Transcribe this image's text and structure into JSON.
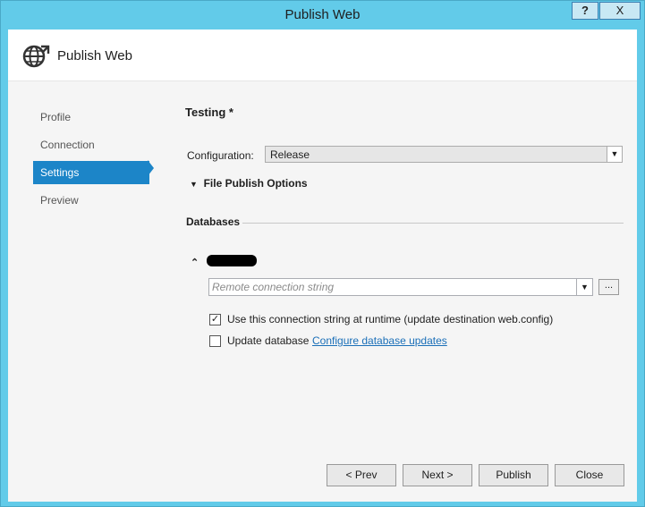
{
  "window": {
    "title": "Publish Web",
    "help_label": "?",
    "close_label": "X"
  },
  "header": {
    "title": "Publish Web",
    "icon": "globe-publish-icon"
  },
  "nav": {
    "items": [
      {
        "label": "Profile",
        "active": false
      },
      {
        "label": "Connection",
        "active": false
      },
      {
        "label": "Settings",
        "active": true
      },
      {
        "label": "Preview",
        "active": false
      }
    ]
  },
  "settings": {
    "profile_title": "Testing *",
    "configuration_label": "Configuration:",
    "configuration_value": "Release",
    "file_publish_options": "File Publish Options",
    "databases_label": "Databases",
    "connection_placeholder": "Remote connection string",
    "ellipsis_label": "...",
    "use_connection_label": "Use this connection string at runtime (update destination web.config)",
    "use_connection_checked": true,
    "update_database_label": "Update database",
    "update_database_checked": false,
    "configure_link": "Configure database updates"
  },
  "buttons": {
    "prev": "< Prev",
    "next": "Next >",
    "publish": "Publish",
    "close": "Close"
  },
  "colors": {
    "chrome": "#62cbe9",
    "accent": "#1c85c8",
    "link": "#1a6fb8"
  }
}
